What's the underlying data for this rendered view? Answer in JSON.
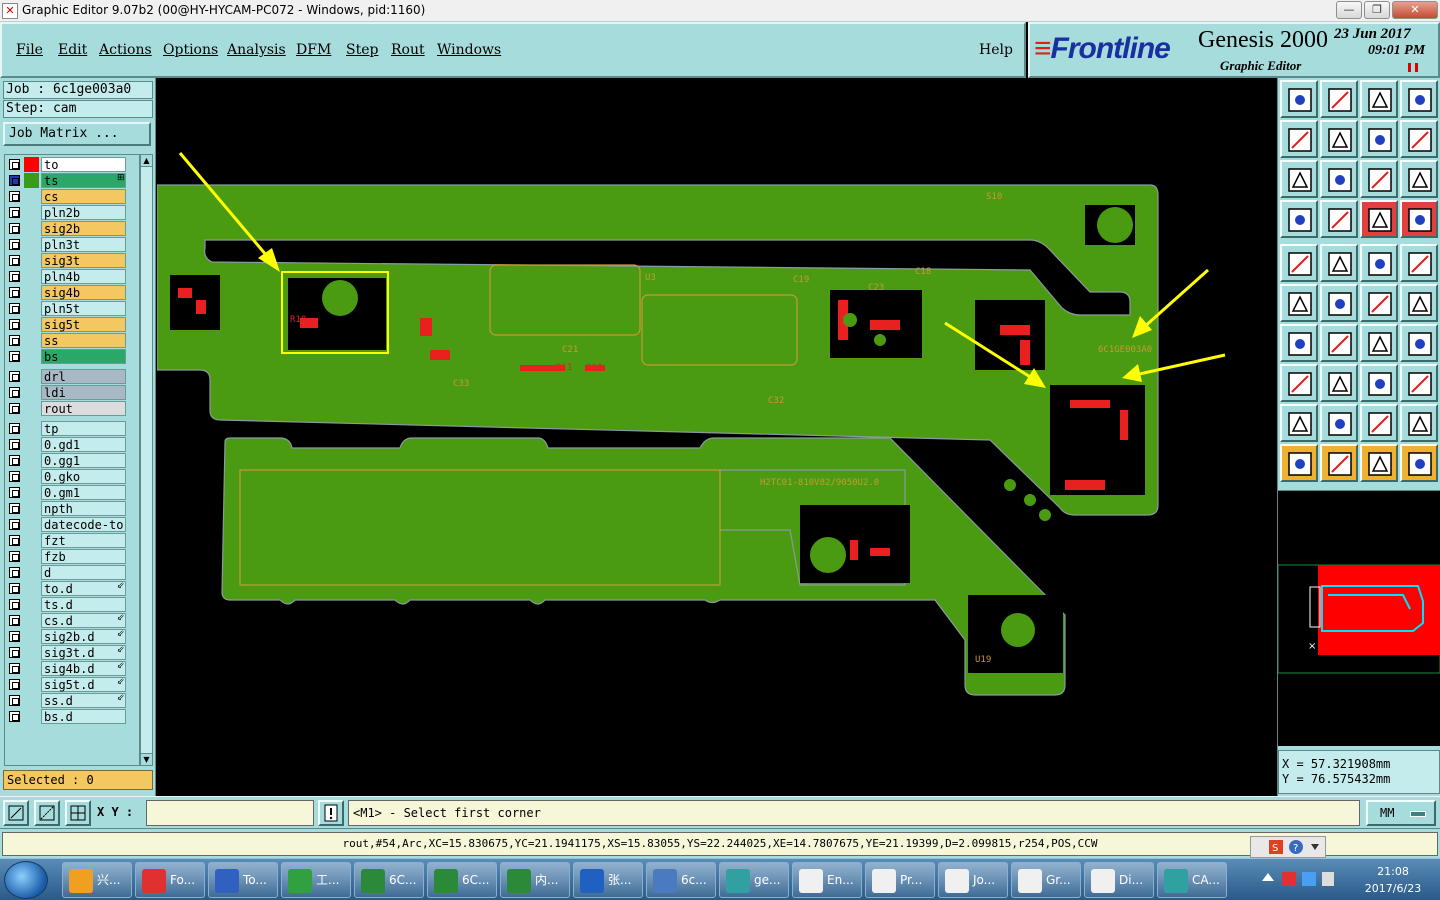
{
  "window": {
    "title": "Graphic Editor 9.07b2 (00@HY-HYCAM-PC072 - Windows, pid:1160)",
    "icon": "graphic-editor-icon"
  },
  "menu": {
    "items": [
      "File",
      "Edit",
      "Actions",
      "Options",
      "Analysis",
      "DFM",
      "Step",
      "Rout",
      "Windows"
    ],
    "help": "Help"
  },
  "brand": {
    "logo": "Frontline",
    "product": "Genesis 2000",
    "subtitle": "Graphic Editor",
    "date": "23  Jun  2017",
    "time": "09:01  PM"
  },
  "job": {
    "job_line": "Job  :  6c1ge003a0",
    "step_line": "Step: cam",
    "matrix_button": "Job Matrix ..."
  },
  "layers": [
    {
      "name": "to",
      "color": "#ffffff",
      "slot": "#ff0000"
    },
    {
      "name": "ts",
      "color": "#2aa86a",
      "slot": "#3a9a1a",
      "mark": "⊞",
      "active": true
    },
    {
      "name": "cs",
      "color": "#f4c860",
      "slot": "#a6dcdc"
    },
    {
      "name": "pln2b",
      "color": "#c4ecec",
      "slot": "#a6dcdc"
    },
    {
      "name": "sig2b",
      "color": "#f4c860",
      "slot": "#a6dcdc"
    },
    {
      "name": "pln3t",
      "color": "#c4ecec",
      "slot": "#a6dcdc"
    },
    {
      "name": "sig3t",
      "color": "#f4c860",
      "slot": "#a6dcdc"
    },
    {
      "name": "pln4b",
      "color": "#c4ecec",
      "slot": "#a6dcdc"
    },
    {
      "name": "sig4b",
      "color": "#f4c860",
      "slot": "#a6dcdc"
    },
    {
      "name": "pln5t",
      "color": "#c4ecec",
      "slot": "#a6dcdc"
    },
    {
      "name": "sig5t",
      "color": "#f4c860",
      "slot": "#a6dcdc"
    },
    {
      "name": "ss",
      "color": "#f4c860",
      "slot": "#a6dcdc"
    },
    {
      "name": "bs",
      "color": "#2aa86a",
      "slot": "#a6dcdc"
    },
    {
      "name": "drl",
      "color": "#a8b8c4",
      "slot": "#a6dcdc"
    },
    {
      "name": "ldi",
      "color": "#a8b8c4",
      "slot": "#a6dcdc"
    },
    {
      "name": "rout",
      "color": "#dcdcdc",
      "slot": "#a6dcdc"
    },
    {
      "name": "tp",
      "color": "#c4ecec",
      "slot": "#a6dcdc"
    },
    {
      "name": "0.gd1",
      "color": "#c4ecec",
      "slot": "#a6dcdc"
    },
    {
      "name": "0.gg1",
      "color": "#c4ecec",
      "slot": "#a6dcdc"
    },
    {
      "name": "0.gko",
      "color": "#c4ecec",
      "slot": "#a6dcdc"
    },
    {
      "name": "0.gm1",
      "color": "#c4ecec",
      "slot": "#a6dcdc"
    },
    {
      "name": "npth",
      "color": "#c4ecec",
      "slot": "#a6dcdc"
    },
    {
      "name": "datecode-to",
      "color": "#c4ecec",
      "slot": "#a6dcdc"
    },
    {
      "name": "fzt",
      "color": "#c4ecec",
      "slot": "#a6dcdc"
    },
    {
      "name": "fzb",
      "color": "#c4ecec",
      "slot": "#a6dcdc"
    },
    {
      "name": "d",
      "color": "#c4ecec",
      "slot": "#a6dcdc"
    },
    {
      "name": "to.d",
      "color": "#c4ecec",
      "slot": "#a6dcdc",
      "mark": "⇙"
    },
    {
      "name": "ts.d",
      "color": "#c4ecec",
      "slot": "#a6dcdc"
    },
    {
      "name": "cs.d",
      "color": "#c4ecec",
      "slot": "#a6dcdc",
      "mark": "⇙"
    },
    {
      "name": "sig2b.d",
      "color": "#c4ecec",
      "slot": "#a6dcdc",
      "mark": "⇙"
    },
    {
      "name": "sig3t.d",
      "color": "#c4ecec",
      "slot": "#a6dcdc",
      "mark": "⇙"
    },
    {
      "name": "sig4b.d",
      "color": "#c4ecec",
      "slot": "#a6dcdc",
      "mark": "⇙"
    },
    {
      "name": "sig5t.d",
      "color": "#c4ecec",
      "slot": "#a6dcdc",
      "mark": "⇙"
    },
    {
      "name": "ss.d",
      "color": "#c4ecec",
      "slot": "#a6dcdc",
      "mark": "⇙"
    },
    {
      "name": "bs.d",
      "color": "#c4ecec",
      "slot": "#a6dcdc"
    }
  ],
  "selected": "Selected : 0",
  "board": {
    "fill_color": "#4a9a12",
    "pad_color": "#e82020",
    "outline_color": "#c89a30",
    "annotation_color": "#ffff00",
    "labels": [
      "U3",
      "C19",
      "C18",
      "C21",
      "C23",
      "C33",
      "C32",
      "R18",
      "6C1GE003A0",
      "H2TC01-810V82/9050U2.0",
      "U19",
      "S10",
      "R11",
      "R10"
    ]
  },
  "coords": {
    "x": "X  =  57.321908mm",
    "y": "Y  =  76.575432mm"
  },
  "command": {
    "xy_label": "X Y :",
    "xy_value": "",
    "prompt": "<M1> - Select first corner",
    "units": "MM"
  },
  "status": "rout,#54,Arc,XC=15.830675,YC=21.1941175,XS=15.83055,YS=22.244025,XE=14.7807675,YE=21.19399,D=2.099815,r254,POS,CCW",
  "taskbar": {
    "tasks": [
      {
        "label": "兴...",
        "color": "#f0a020"
      },
      {
        "label": "Fo...",
        "color": "#e03030"
      },
      {
        "label": "To...",
        "color": "#3060c0"
      },
      {
        "label": "工...",
        "color": "#30a040"
      },
      {
        "label": "6C...",
        "color": "#2a8a3a"
      },
      {
        "label": "6C...",
        "color": "#2a8a3a"
      },
      {
        "label": "内...",
        "color": "#2a8a3a"
      },
      {
        "label": "张...",
        "color": "#2060c0"
      },
      {
        "label": "6c...",
        "color": "#4a7ac0"
      },
      {
        "label": "ge...",
        "color": "#30a0a0"
      },
      {
        "label": "En...",
        "color": "#f0f0f0"
      },
      {
        "label": "Pr...",
        "color": "#f0f0f0"
      },
      {
        "label": "Jo...",
        "color": "#f0f0f0"
      },
      {
        "label": "Gr...",
        "color": "#f0f0f0"
      },
      {
        "label": "Di...",
        "color": "#f0f0f0"
      },
      {
        "label": "CA...",
        "color": "#30a0a0"
      }
    ],
    "clock_time": "21:08",
    "clock_date": "2017/6/23"
  }
}
